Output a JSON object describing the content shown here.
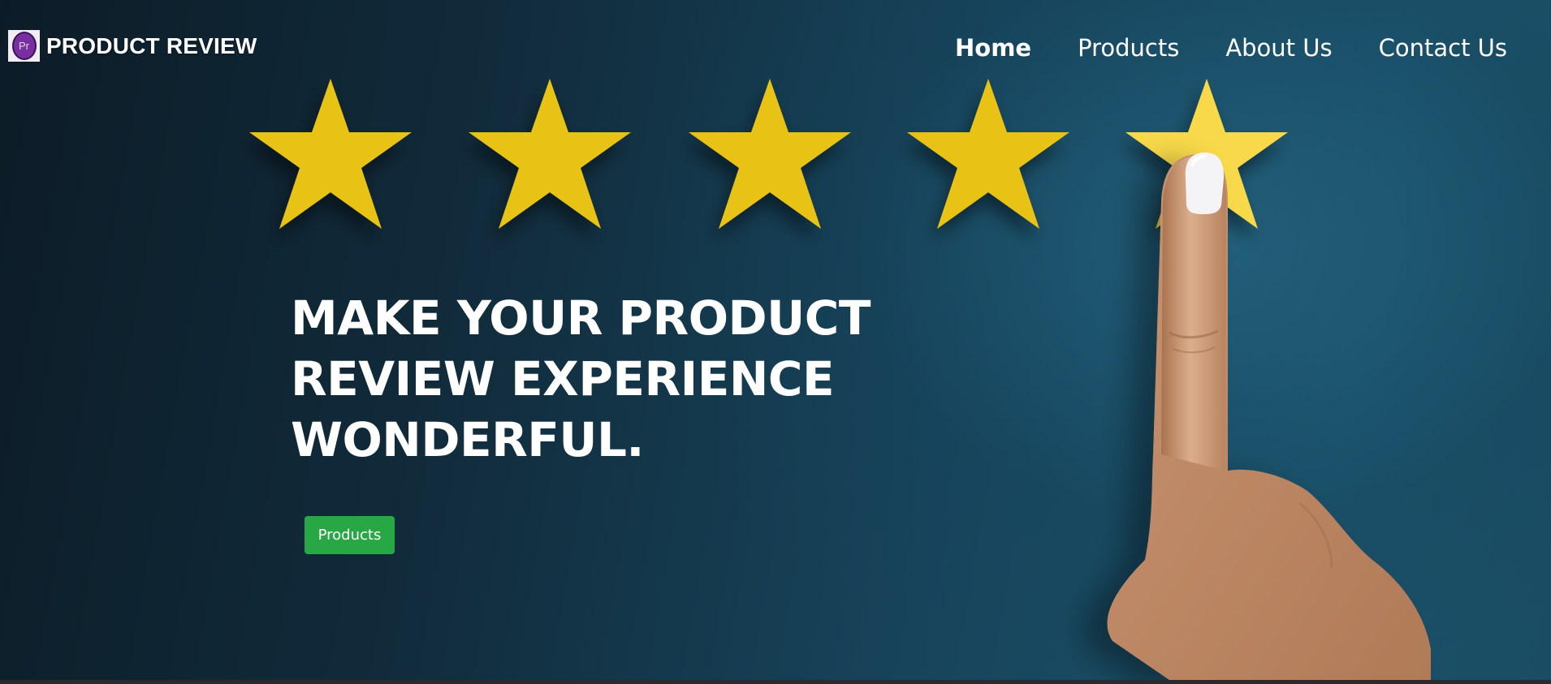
{
  "brand": {
    "name": "PRODUCT REVIEW",
    "logo_letters": "Pr",
    "logo_icon": "premiere-pro-icon"
  },
  "nav": {
    "items": [
      {
        "label": "Home",
        "active": true
      },
      {
        "label": "Products",
        "active": false
      },
      {
        "label": "About Us",
        "active": false
      },
      {
        "label": "Contact Us",
        "active": false
      }
    ]
  },
  "hero": {
    "headline_lines": [
      "MAKE YOUR PRODUCT",
      "REVIEW EXPERIENCE",
      "WONDERFUL."
    ],
    "cta_label": "Products",
    "rating_stars": 5,
    "background_image": "five-star-rating-with-pointing-finger"
  },
  "colors": {
    "star": "#e8c312",
    "star_highlight": "#f7d94a",
    "cta": "#28a745",
    "background_dark": "#0c1c27",
    "background_light": "#1b5169"
  }
}
